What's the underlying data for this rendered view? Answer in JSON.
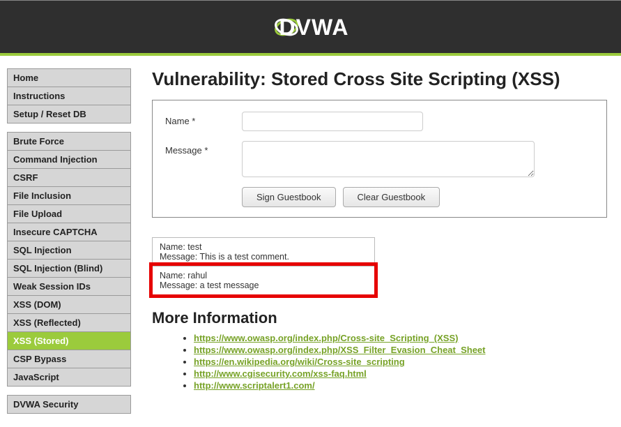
{
  "logo_text": "DVWA",
  "sidebar": {
    "groups": [
      [
        {
          "label": "Home",
          "key": "home"
        },
        {
          "label": "Instructions",
          "key": "instructions"
        },
        {
          "label": "Setup / Reset DB",
          "key": "setup"
        }
      ],
      [
        {
          "label": "Brute Force",
          "key": "brute-force"
        },
        {
          "label": "Command Injection",
          "key": "cmd-inj"
        },
        {
          "label": "CSRF",
          "key": "csrf"
        },
        {
          "label": "File Inclusion",
          "key": "file-inclusion"
        },
        {
          "label": "File Upload",
          "key": "file-upload"
        },
        {
          "label": "Insecure CAPTCHA",
          "key": "captcha"
        },
        {
          "label": "SQL Injection",
          "key": "sqli"
        },
        {
          "label": "SQL Injection (Blind)",
          "key": "sqli-blind"
        },
        {
          "label": "Weak Session IDs",
          "key": "weak-session"
        },
        {
          "label": "XSS (DOM)",
          "key": "xss-dom"
        },
        {
          "label": "XSS (Reflected)",
          "key": "xss-reflected"
        },
        {
          "label": "XSS (Stored)",
          "key": "xss-stored",
          "active": true
        },
        {
          "label": "CSP Bypass",
          "key": "csp"
        },
        {
          "label": "JavaScript",
          "key": "js"
        }
      ],
      [
        {
          "label": "DVWA Security",
          "key": "security"
        }
      ]
    ]
  },
  "main": {
    "heading": "Vulnerability: Stored Cross Site Scripting (XSS)",
    "form": {
      "name_label": "Name *",
      "message_label": "Message *",
      "name_value": "",
      "message_value": "",
      "sign_button": "Sign Guestbook",
      "clear_button": "Clear Guestbook"
    },
    "entries": [
      {
        "name": "test",
        "message": "This is a test comment.",
        "highlight": false
      },
      {
        "name": "rahul",
        "message": "a test message",
        "highlight": true
      }
    ],
    "entry_name_prefix": "Name: ",
    "entry_msg_prefix": "Message: ",
    "more_heading": "More Information",
    "links": [
      "https://www.owasp.org/index.php/Cross-site_Scripting_(XSS)",
      "https://www.owasp.org/index.php/XSS_Filter_Evasion_Cheat_Sheet",
      "https://en.wikipedia.org/wiki/Cross-site_scripting",
      "http://www.cgisecurity.com/xss-faq.html",
      "http://www.scriptalert1.com/"
    ]
  }
}
